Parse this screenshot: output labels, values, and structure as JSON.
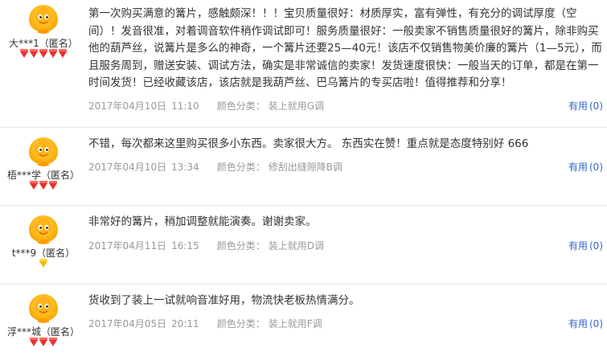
{
  "reviews": [
    {
      "user": "大***1（匿名）",
      "gem_color": "red",
      "gems": 5,
      "text": "第一次购买满意的篝片，感触颇深！！！宝贝质量很好：材质厚实，富有弹性，有充分的调试厚度（空间）！发音很准，对着调音软件稍作调试即可！服务质量很好：一般卖家不销售质量很好的篝片，除非购买他的葫芦丝，说篝片是多么的神奇，一个篝片还要25—40元！该店不仅销售物美价廉的篝片（1—5元），而且服务周到，赠送安装、调试方法，确实是非常诚信的卖家！发货速度很快：一般当天的订单，都是在第一时间发货！已经收藏该店，该店就是我葫芦丝、巴乌篝片的专买店啦！值得推荐和分享！",
      "date": "2017年04月10日",
      "time": "11:10",
      "sku_label": "颜色分类：",
      "sku_value": "装上就用G调",
      "useful_label": "有用",
      "useful_count": "(0)"
    },
    {
      "user": "梧***学（匿名）",
      "gem_color": "red",
      "gems": 3,
      "text": "不错，每次都来这里购买很多小东西。卖家很大方。 东西实在赞！重点就是态度特别好 666",
      "date": "2017年04月10日",
      "time": "13:34",
      "sku_label": "颜色分类：",
      "sku_value": "修刮出缝隙降B调",
      "useful_label": "有用",
      "useful_count": "(0)"
    },
    {
      "user": "t***9（匿名）",
      "gem_color": "yellow",
      "gems": 1,
      "text": "非常好的篝片，稍加调整就能演奏。谢谢卖家。",
      "date": "2017年04月11日",
      "time": "16:15",
      "sku_label": "颜色分类：",
      "sku_value": "装上就用D调",
      "useful_label": "有用",
      "useful_count": "(0)"
    },
    {
      "user": "浮***城（匿名）",
      "gem_color": "red",
      "gems": 3,
      "text": "货收到了装上一试就响音准好用，物流快老板热情满分。",
      "date": "2017年04月05日",
      "time": "20:11",
      "sku_label": "颜色分类：",
      "sku_value": "装上就用F调",
      "useful_label": "有用",
      "useful_count": "(0)"
    }
  ]
}
